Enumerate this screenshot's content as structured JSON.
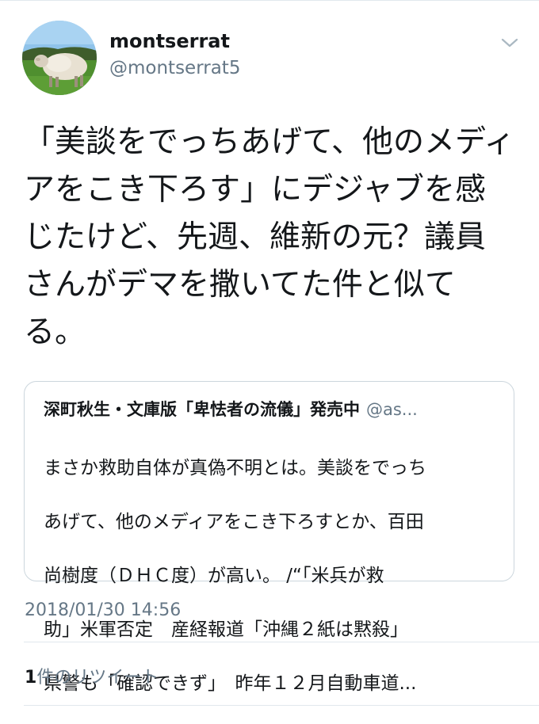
{
  "user": {
    "display_name": "montserrat",
    "handle": "@montserrat5",
    "avatar_icon": "sheep-avatar-icon"
  },
  "menu": {
    "caret_icon": "chevron-down-icon"
  },
  "tweet": {
    "text": "「美談をでっちあげて、他のメディアをこき下ろす」にデジャブを感じたけど、先週、維新の元？議員さんがデマを撒いてた件と似てる。"
  },
  "quoted_tweet": {
    "author_name": "深町秋生・文庫版「卑怯者の流儀」発売中",
    "author_handle": "@as...",
    "lines": [
      "まさか救助自体が真偽不明とは。美談をでっち",
      "あげて、他のメディアをこき下ろすとか、百田",
      "尚樹度（ＤＨＣ度）が高い。 /“「米兵が救",
      "助」米軍否定　産経報道「沖縄２紙は黙殺」",
      "県警も「確認できず」　昨年１２月自動車道..."
    ]
  },
  "meta": {
    "timestamp": "2018/01/30 14:56"
  },
  "stats": {
    "retweet_count": "1",
    "retweet_label": "件のリツイート"
  },
  "colors": {
    "primary_text": "#14171a",
    "secondary_text": "#657786",
    "border": "#ccd6dd",
    "divider": "#e1e8ed"
  }
}
